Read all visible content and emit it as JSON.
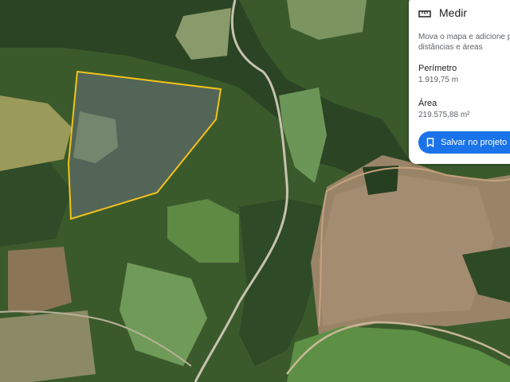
{
  "panel": {
    "title": "Medir",
    "description_line1": "Mova o mapa e adicione p",
    "description_line2": "distâncias e áreas",
    "perimeter_label": "Perímetro",
    "perimeter_value": "1.919,75 m",
    "area_label": "Área",
    "area_value": "219.575,88 m²",
    "save_button_label": "Salvar no projeto",
    "icons": [
      "ruler-icon",
      "bookmark-icon"
    ]
  },
  "map": {
    "measurement_outline_color": "#f2c21b",
    "accent_color": "#1a73e8"
  }
}
